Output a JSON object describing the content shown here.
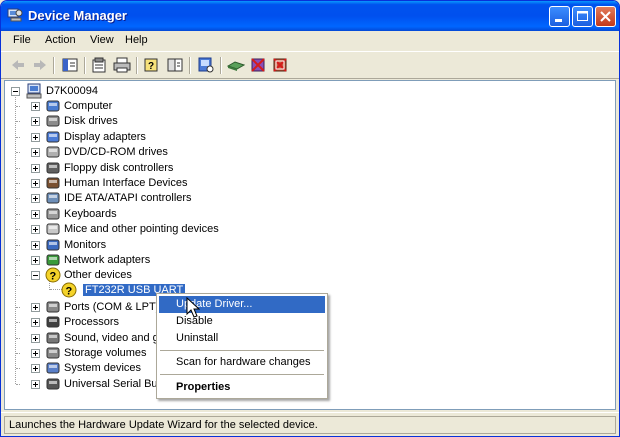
{
  "window": {
    "title": "Device Manager"
  },
  "menubar": {
    "items": [
      "File",
      "Action",
      "View",
      "Help"
    ]
  },
  "toolbar": {
    "buttons": [
      "back-icon",
      "forward-icon",
      "show-hide-console-tree-icon",
      "properties-icon",
      "print-icon",
      "help-icon",
      "view-icon",
      "scan-hardware-icon",
      "update-driver-icon",
      "disable-icon",
      "uninstall-icon"
    ]
  },
  "tree": {
    "root": "D7K00094",
    "categories": [
      {
        "label": "Computer",
        "icon": "computer-icon"
      },
      {
        "label": "Disk drives",
        "icon": "disk-drive-icon"
      },
      {
        "label": "Display adapters",
        "icon": "display-adapter-icon"
      },
      {
        "label": "DVD/CD-ROM drives",
        "icon": "cdrom-icon"
      },
      {
        "label": "Floppy disk controllers",
        "icon": "floppy-icon"
      },
      {
        "label": "Human Interface Devices",
        "icon": "hid-icon"
      },
      {
        "label": "IDE ATA/ATAPI controllers",
        "icon": "ide-icon"
      },
      {
        "label": "Keyboards",
        "icon": "keyboard-icon"
      },
      {
        "label": "Mice and other pointing devices",
        "icon": "mouse-icon"
      },
      {
        "label": "Monitors",
        "icon": "monitor-icon"
      },
      {
        "label": "Network adapters",
        "icon": "network-icon"
      },
      {
        "label": "Other devices",
        "icon": "unknown-device-icon",
        "expanded": true
      },
      {
        "label": "Ports (COM & LPT)",
        "icon": "port-icon"
      },
      {
        "label": "Processors",
        "icon": "processor-icon"
      },
      {
        "label": "Sound, video and game controllers",
        "icon": "sound-icon"
      },
      {
        "label": "Storage volumes",
        "icon": "storage-icon"
      },
      {
        "label": "System devices",
        "icon": "system-icon"
      },
      {
        "label": "Universal Serial Bus controllers",
        "icon": "usb-icon"
      }
    ],
    "child": {
      "label": "FT232R USB UART",
      "icon": "unknown-device-warning-icon"
    }
  },
  "context_menu": {
    "items": [
      "Update Driver...",
      "Disable",
      "Uninstall",
      "Scan for hardware changes",
      "Properties"
    ],
    "highlighted": "Update Driver..."
  },
  "status": {
    "text": "Launches the Hardware Update Wizard for the selected device."
  },
  "colors": {
    "titlebar": "#0053ee",
    "selection": "#316ac5",
    "face": "#ece9d8"
  }
}
